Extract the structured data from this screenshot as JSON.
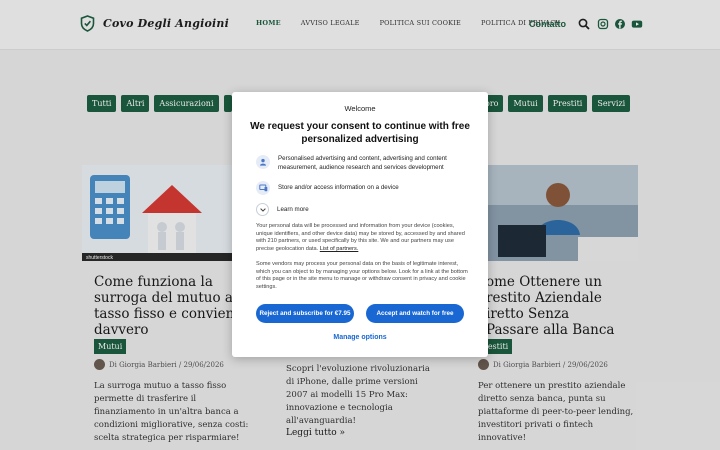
{
  "header": {
    "logo_text": "Covo Degli Angioini",
    "nav": [
      "HOME",
      "AVVISO LEGALE",
      "POLITICA SUI COOKIE",
      "POLITICA DI PRIVACY"
    ],
    "contact": "Contatto",
    "icons": [
      "search-icon",
      "instagram-icon",
      "facebook-icon",
      "youtube-icon"
    ]
  },
  "filters_left": [
    "Tutti",
    "Altri",
    "Assicurazioni"
  ],
  "filters_right": [
    "oro",
    "Mutui",
    "Prestiti",
    "Servizi"
  ],
  "cards": [
    {
      "title": "Come funziona la surroga del mutuo a tasso fisso e conviene davvero",
      "category": "Mutui",
      "author_date": "Di Giorgia Barbieri / 29/06/2026",
      "excerpt": "La surroga mutuo a tasso fisso permette di trasferire il finanziamento in un'altra banca a condizioni migliorative, senza costi: scelta strategica per risparmiare!",
      "image_caption": "shutterstock"
    },
    {
      "excerpt": "Scopri l'evoluzione rivoluzionaria di iPhone, dalle prime versioni 2007 ai modelli 15 Pro Max: innovazione e tecnologia all'avanguardia!",
      "read_more": "Leggi tutto »"
    },
    {
      "title": "ome Ottenere un restito Aziendale iretto Senza Passare alla Banca",
      "category": "restiti",
      "author_date": "Di Giorgia Barbieri / 29/06/2026",
      "excerpt": "Per ottenere un prestito aziendale diretto senza banca, punta su piattaforme di peer-to-peer lending, investitori privati o fintech innovative!"
    }
  ],
  "dialog": {
    "welcome": "Welcome",
    "title": "We request your consent to continue with free personalized advertising",
    "purposes": [
      "Personalised advertising and content, advertising and content measurement, audience research and services development",
      "Store and/or access information on a device"
    ],
    "learn_more": "Learn more",
    "para1": "Your personal data will be processed and information from your device (cookies, unique identifiers, and other device data) may be stored by, accessed by and shared with 210 partners, or used specifically by this site. We and our partners may use precise geolocation data.",
    "partners_link": "List of partners.",
    "para2": "Some vendors may process your personal data on the basis of legitimate interest, which you can object to by managing your options below. Look for a link at the bottom of this page or in the site menu to manage or withdraw consent in privacy and cookie settings.",
    "btn_subscribe": "Reject and subscribe for €7.95",
    "btn_accept": "Accept and watch for free",
    "manage": "Manage options"
  },
  "colors": {
    "brand_green": "#1d5e40",
    "consent_blue": "#1967d2"
  }
}
